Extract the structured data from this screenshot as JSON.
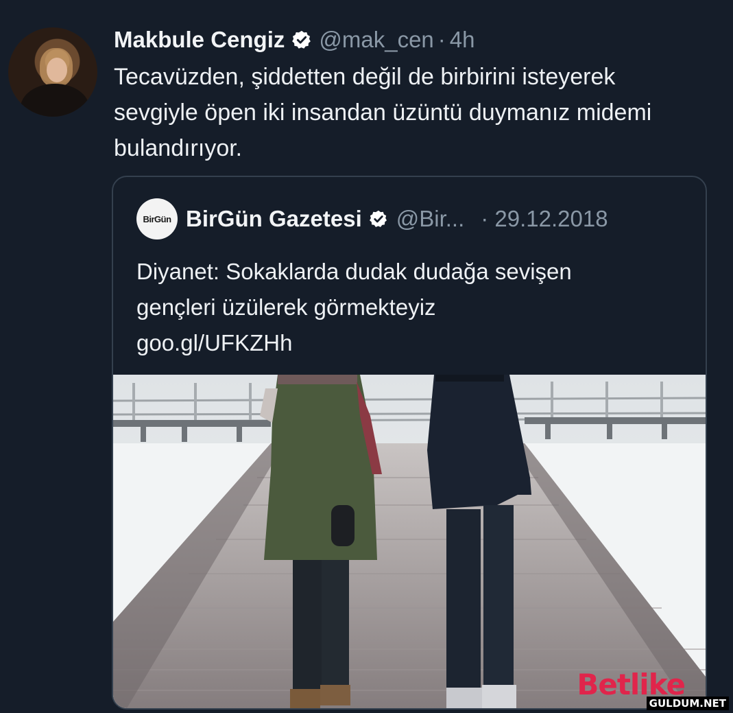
{
  "tweet": {
    "author_name": "Makbule Cengiz",
    "handle": "@mak_cen",
    "separator": "·",
    "time": "4h",
    "text": "Tecavüzden, şiddetten değil de birbirini isteyerek sevgiyle öpen iki insandan üzüntü duymanız midemi bulandırıyor.",
    "verified": true
  },
  "quoted": {
    "logo_text": "BirGün",
    "author_name": "BirGün Gazetesi",
    "handle": "@Bir...",
    "date": "· 29.12.2018",
    "text_line1": "Diyanet: Sokaklarda dudak dudağa sevişen",
    "text_line2": "gençleri üzülerek görmekteyiz",
    "link": "goo.gl/UFKZHh",
    "verified": true
  },
  "watermarks": {
    "brand_part1": "Bet",
    "brand_part2": "like",
    "site": "GULDUM.NET"
  },
  "colors": {
    "background": "#151d29",
    "text": "#eef1f4",
    "muted": "#8a98a6",
    "card_border": "#34404e",
    "brand_red": "#e0254b"
  },
  "icons": {
    "verified": "verified-badge-icon"
  }
}
